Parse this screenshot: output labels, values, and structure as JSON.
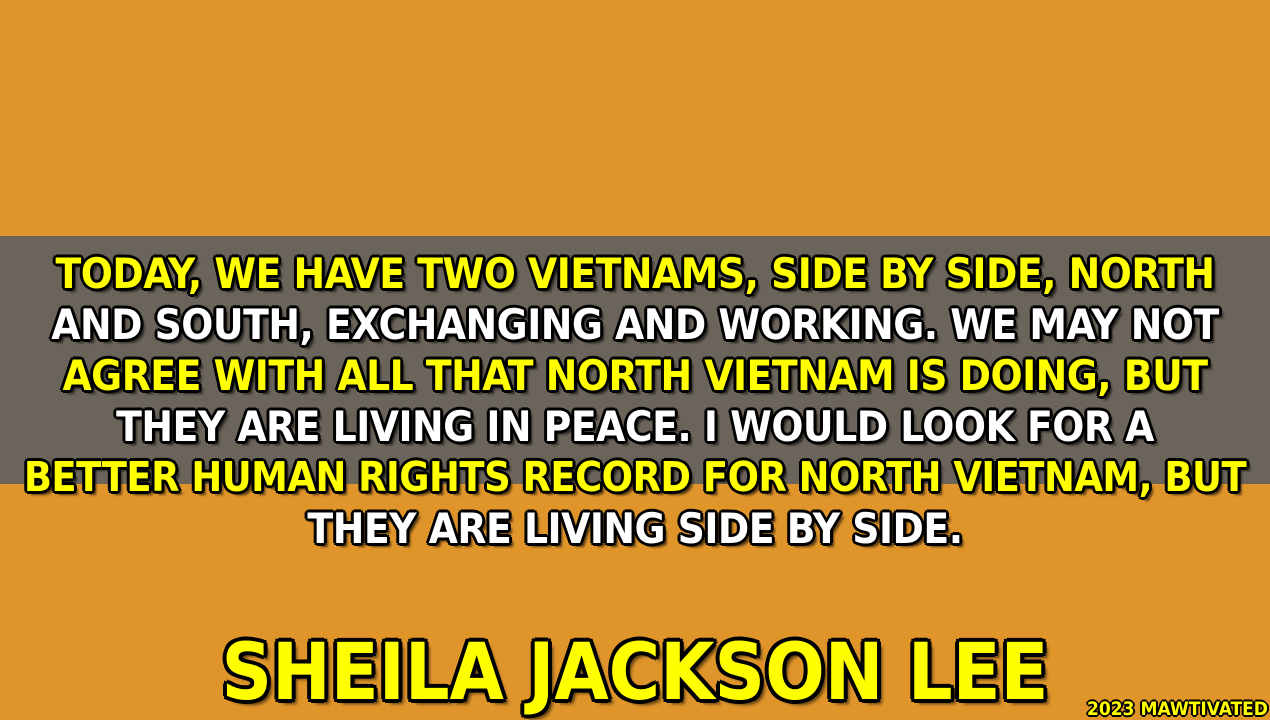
{
  "colors": {
    "background": "#e0952b",
    "band": "#6b645a",
    "yellow_text": "#ffff00",
    "white_text": "#ffffff",
    "outline": "#000000"
  },
  "quote": {
    "lines": [
      "TODAY, WE HAVE TWO VIETNAMS, SIDE BY SIDE, NORTH",
      "AND SOUTH, EXCHANGING AND WORKING. WE MAY NOT",
      "AGREE WITH ALL THAT NORTH VIETNAM IS DOING, BUT",
      "THEY ARE LIVING IN PEACE. I WOULD LOOK FOR A",
      "BETTER HUMAN RIGHTS RECORD FOR NORTH VIETNAM, BUT",
      "THEY ARE LIVING SIDE BY SIDE."
    ]
  },
  "author": "SHEILA JACKSON LEE",
  "watermark": "2023 MAWTIVATED"
}
